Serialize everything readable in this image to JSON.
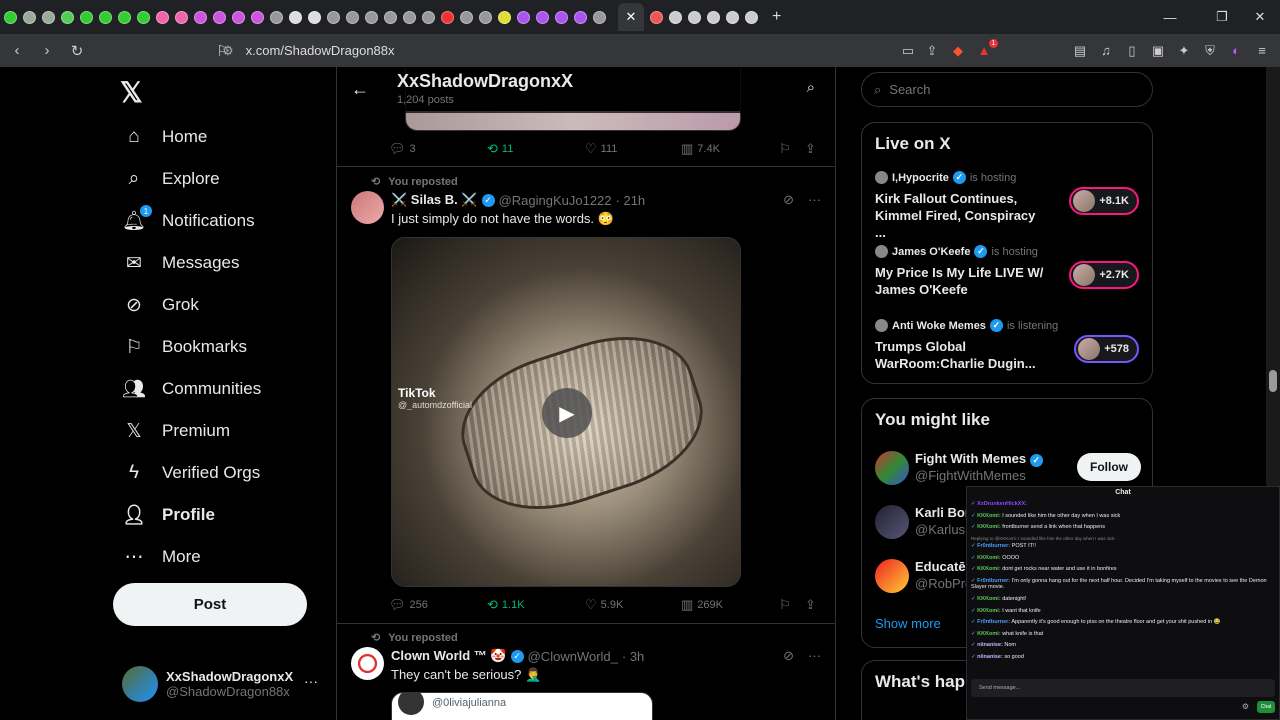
{
  "browser": {
    "url": "x.com/ShadowDragon88x",
    "active_tab_icon": "close-icon",
    "tab_favicon_colors": [
      "#3c3",
      "#9a9",
      "#9a9",
      "#5c5",
      "#3c3",
      "#3c3",
      "#3c3",
      "#3c3",
      "#e6a",
      "#e6a",
      "#c5d",
      "#c5d",
      "#c5d",
      "#c5d",
      "#999",
      "#ddd",
      "#ddd",
      "#999",
      "#999",
      "#999",
      "#999",
      "#999",
      "#999",
      "#e33",
      "#999",
      "#999",
      "#dd3",
      "#a5e",
      "#a5e",
      "#a5e",
      "#a5e",
      "#999",
      "#e55",
      "#ccc",
      "#ccc",
      "#ccc",
      "#ccc",
      "#ccc"
    ],
    "brave_badge": "1"
  },
  "nav": {
    "items": [
      {
        "label": "Home",
        "icon": "home-icon",
        "glyph": "⌂"
      },
      {
        "label": "Explore",
        "icon": "search-icon",
        "glyph": "⌕"
      },
      {
        "label": "Notifications",
        "icon": "bell-icon",
        "glyph": "🔔︎"
      },
      {
        "label": "Messages",
        "icon": "envelope-icon",
        "glyph": "✉"
      },
      {
        "label": "Grok",
        "icon": "grok-icon",
        "glyph": "⊘"
      },
      {
        "label": "Bookmarks",
        "icon": "bookmark-icon",
        "glyph": "⚐"
      },
      {
        "label": "Communities",
        "icon": "people-icon",
        "glyph": "👥︎"
      },
      {
        "label": "Premium",
        "icon": "x-logo-icon",
        "glyph": "𝕏"
      },
      {
        "label": "Verified Orgs",
        "icon": "lightning-icon",
        "glyph": "ϟ"
      },
      {
        "label": "Profile",
        "icon": "person-icon",
        "glyph": "👤︎"
      },
      {
        "label": "More",
        "icon": "more-circle-icon",
        "glyph": "⋯"
      }
    ],
    "notification_badge": "1",
    "post_label": "Post",
    "account": {
      "name": "XxShadowDragonxX",
      "handle": "@ShadowDragon88x"
    }
  },
  "profile_header": {
    "name": "XxShadowDragonxX",
    "post_count": "1,204 posts"
  },
  "top_tweet_actions": {
    "replies": "3",
    "reposts": "11",
    "likes": "111",
    "views": "7.4K"
  },
  "tweets": [
    {
      "reposted_label": "You reposted",
      "name": "⚔️ Silas B. ⚔️",
      "handle": "@RagingKuJo1222",
      "time": "· 21h",
      "text": "I just simply do not have the words. 😳",
      "video_watermark": "TikTok",
      "video_watermark_handle": "@_automdzofficial",
      "actions": {
        "replies": "256",
        "reposts": "1.1K",
        "likes": "5.9K",
        "views": "269K"
      }
    },
    {
      "reposted_label": "You reposted",
      "name": "Clown World ™ 🤡",
      "handle": "@ClownWorld_",
      "time": "· 3h",
      "text": "They can't be serious? 🤦‍♂️",
      "quote_handle": "@0liviajulianna"
    }
  ],
  "right": {
    "search_placeholder": "Search",
    "live": {
      "title": "Live on X",
      "items": [
        {
          "host": "I,Hypocrite",
          "status": "is hosting",
          "title": "Kirk Fallout Continues, Kimmel Fired, Conspiracy ...",
          "count": "+8.1K"
        },
        {
          "host": "James O'Keefe",
          "status": "is hosting",
          "title": "My Price Is My Life LIVE W/ James O'Keefe",
          "count": "+2.7K"
        },
        {
          "host": "Anti Woke Memes",
          "status": "is listening",
          "title": "Trumps Global WarRoom:Charlie Dugin...",
          "count": "+578"
        }
      ]
    },
    "wtf": {
      "title": "You might like",
      "items": [
        {
          "name": "Fight With Memes",
          "handle": "@FightWithMemes",
          "follow": "Follow"
        },
        {
          "name": "Karli Bor",
          "handle": "@KarlusK"
        },
        {
          "name": "Educatē",
          "handle": "@RobPro"
        }
      ],
      "show_more": "Show more"
    },
    "happening_title": "What's hap"
  },
  "chat": {
    "title": "Chat",
    "messages": [
      {
        "user": "XxDrunkenHickXX:",
        "text": "",
        "color": "#9146ff"
      },
      {
        "user": "KKKomi:",
        "text": "I sounded like him the other day when I was sick",
        "color": "#5dc95d"
      },
      {
        "user": "KKKomi:",
        "text": "frontburner send a link when that happens",
        "color": "#5dc95d"
      },
      {
        "reply": "Replying to @KKKomi: I sounded like him the other day when I was sick",
        "user": "Fr0ntburner:",
        "text": "POST IT!!",
        "color": "#4f9cff"
      },
      {
        "user": "KKKomi:",
        "text": "OOOO",
        "color": "#5dc95d"
      },
      {
        "user": "KKKomi:",
        "text": "dont get rocks near water and use it in bonfires",
        "color": "#5dc95d"
      },
      {
        "user": "Fr0ntburner:",
        "text": "I'm only gonna hang out for the next half hour. Decided I'm taking myself to the movies to see the Demon Slayer movie.",
        "color": "#4f9cff"
      },
      {
        "user": "KKKomi:",
        "text": "datenight!",
        "color": "#5dc95d"
      },
      {
        "user": "KKKomi:",
        "text": "I want that knife",
        "color": "#5dc95d"
      },
      {
        "user": "Fr0ntburner:",
        "text": "Apparently it's good enough to piss on the theatre floor and get your shit pushed in 😂",
        "color": "#4f9cff"
      },
      {
        "user": "KKKomi:",
        "text": "what knife is that",
        "color": "#5dc95d"
      },
      {
        "user": "niinanise:",
        "text": "Nom",
        "color": "#c6b3ff"
      },
      {
        "user": "niinanise:",
        "text": "so good",
        "color": "#c6b3ff"
      }
    ],
    "input_placeholder": "Send message...",
    "send_label": "Chat"
  }
}
